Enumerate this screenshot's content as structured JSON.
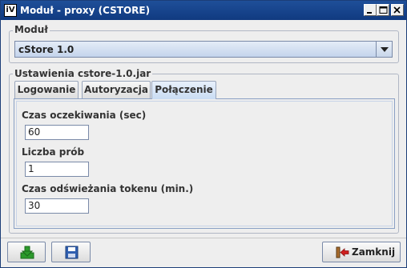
{
  "window": {
    "title": "Moduł - proxy (CSTORE)",
    "app_icon_text": "iV"
  },
  "modul": {
    "label": "Moduł",
    "selected": "cStore 1.0"
  },
  "settings": {
    "label": "Ustawienia cstore-1.0.jar",
    "tabs": [
      {
        "label": "Logowanie",
        "active": false
      },
      {
        "label": "Autoryzacja",
        "active": false
      },
      {
        "label": "Połączenie",
        "active": true
      }
    ],
    "fields": [
      {
        "label": "Czas oczekiwania (sec)",
        "value": "60"
      },
      {
        "label": "Liczba prób",
        "value": "1"
      },
      {
        "label": "Czas odświeżania tokenu (min.)",
        "value": "30"
      }
    ]
  },
  "buttons": {
    "download_icon": "download-icon",
    "save_icon": "floppy-disk-icon",
    "close_label": "Zamknij",
    "close_icon": "exit-door-icon"
  },
  "colors": {
    "titlebar": "#1f4f99",
    "combo_bg": "#c4d4ec",
    "tab_active": "#c9dcf3",
    "download_green": "#2c9a2c",
    "save_blue": "#2f5fb0",
    "close_red": "#d02020"
  }
}
